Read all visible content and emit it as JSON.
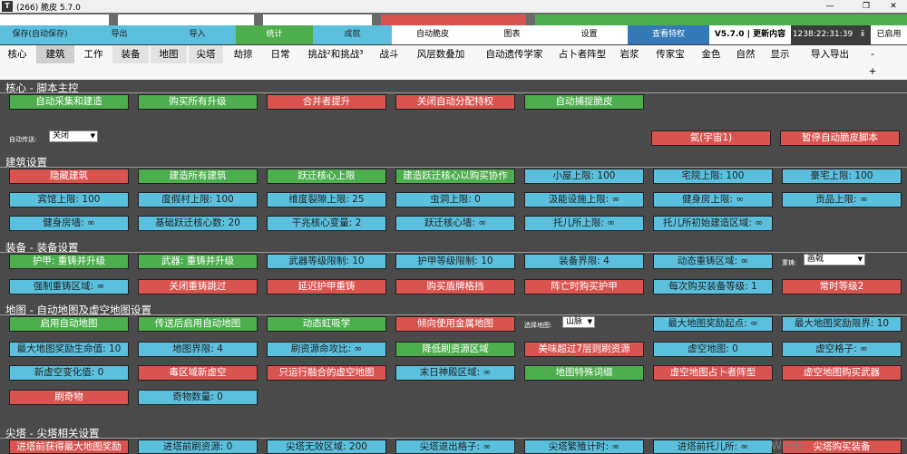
{
  "window": {
    "icon_text": "T",
    "title": "(266) 脆皮 5.7.0",
    "min": "—",
    "max": "❐",
    "close": "✕"
  },
  "top_buttons": [
    {
      "label": "保存(自动保存)",
      "color": "#5bc0de"
    },
    {
      "label": "导出",
      "color": "#5bc0de"
    },
    {
      "label": "导入",
      "color": "#5bc0de"
    },
    {
      "label": "统计",
      "color": "#4cae4c"
    },
    {
      "label": "成就",
      "color": "#5bc0de"
    },
    {
      "label": "自动脆皮",
      "color": "#ffffff"
    },
    {
      "label": "图表",
      "color": "#ffffff"
    },
    {
      "label": "设置",
      "color": "#ffffff"
    },
    {
      "label": "查看特权",
      "color": "#337ab7"
    },
    {
      "label": "V5.7.0 | 更新内容",
      "color": "#ffffff"
    },
    {
      "label": "1238:22:31:39",
      "color": "#3c3c3c"
    },
    {
      "label": "ⅱ",
      "color": "#3c3c3c"
    },
    {
      "label": "已启用",
      "color": "#ffffff"
    }
  ],
  "nav_tabs": [
    "核心",
    "建筑",
    "工作",
    "装备",
    "地图",
    "尖塔",
    "劫掠",
    "日常",
    "挑战²和挑战³",
    "战斗",
    "风层数叠加",
    "自动遗传学家",
    "占卜者阵型",
    "岩浆",
    "传家宝",
    "金色",
    "自然",
    "显示",
    "导入导出"
  ],
  "nav_extra": {
    "minus": "-",
    "plus": "+"
  },
  "sections": {
    "core": "核心 - 脚本主控",
    "building": "建筑设置",
    "equipment": "装备 - 装备设置",
    "map": "地图 - 自动地图及虚空地图设置",
    "spire": "尖塔 - 尖塔相关设置"
  },
  "core_buttons": [
    "自动采集和建造",
    "购买所有升级",
    "合并者提升",
    "关闭自动分配特权",
    "自动捕捉脆皮"
  ],
  "core_label": "自动传送:",
  "core_select": "关闭",
  "core_right_buttons": [
    "氦(宇宙1)",
    "暂停自动脆皮脚本"
  ],
  "building_buttons": [
    [
      "隐藏建筑",
      "建造所有建筑",
      "跃迁核心上限",
      "建造跃迁核心以购买协作",
      "小屋上限: 100",
      "宅院上限: 100",
      "豪宅上限: 100"
    ],
    [
      "宾馆上限: 100",
      "度假村上限: 100",
      "维度裂隙上限: 25",
      "虫洞上限: 0",
      "汲能设施上限: ∞",
      "健身房上限: ∞",
      "贡品上限: ∞"
    ],
    [
      "健身房墙: ∞",
      "基础跃迁核心数: 20",
      "干兆核心变量: 2",
      "跃迁核心墙: ∞",
      "托儿所上限: ∞",
      "托儿所初始建造区域: ∞"
    ]
  ],
  "equipment_buttons": [
    [
      "护甲: 重铸并升级",
      "武器: 重铸并升级",
      "武器等级限制: 10",
      "护甲等级限制: 10",
      "装备界限: 4",
      "动态重铸区域: ∞"
    ],
    [
      "强制重铸区域: ∞",
      "关闭重铸跳过",
      "延迟护甲重铸",
      "购买盾牌格挡",
      "阵亡时购买护甲",
      "每次购买装备等级: 1",
      "常时等级2"
    ]
  ],
  "equipment_label": "重铸:",
  "equipment_select": "画戟",
  "map_buttons": [
    [
      "启用自动地图",
      "传送后启用自动地图",
      "动态虹吸学",
      "倾向使用金属地图"
    ],
    [
      "最大地图奖励起点: ∞",
      "最大地图奖励限界: 10"
    ],
    [
      "最大地图奖励生命值: 10",
      "地图界限: 4",
      "刷资源命攻比: ∞",
      "降低刷资源区域",
      "美味超过7层则刷资源",
      "虚空地图: 0",
      "虚空格子: ∞"
    ],
    [
      "新虚空变化值: 0",
      "毒区域新虚空",
      "只运行融合的虚空地图",
      "末日神殿区域: ∞",
      "地图特殊词缀",
      "虚空地图占卜者阵型",
      "虚空地图购买武器"
    ],
    [
      "刷奇物",
      "奇物数量: 0"
    ]
  ],
  "map_label": "选择地图:",
  "map_select": "山脉",
  "spire_buttons": [
    "进塔前获得最大地图奖励",
    "进塔前刷资源: 0",
    "尖塔无效区域: 200",
    "尖塔退出格子: ∞",
    "尖塔繁殖计时: ∞",
    "进塔前托儿所: ∞",
    "尖塔购买装备"
  ],
  "watermark": "Windo"
}
